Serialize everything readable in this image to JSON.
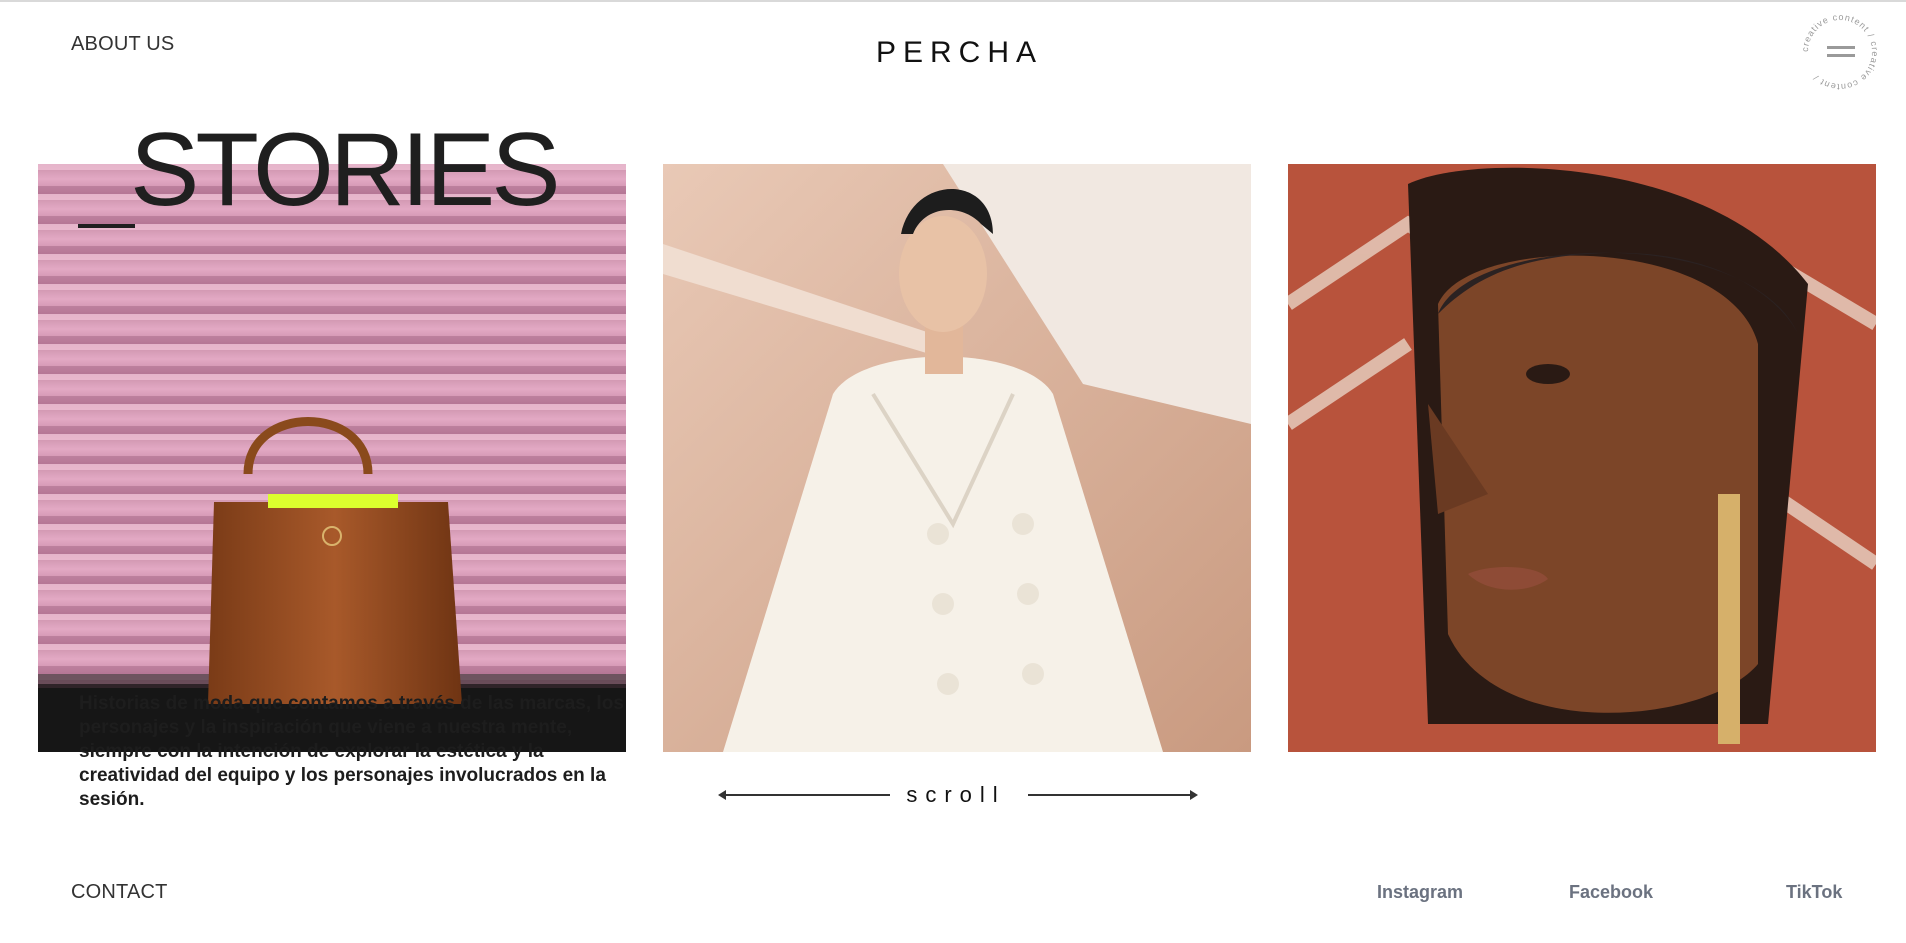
{
  "header": {
    "about_label": "ABOUT US",
    "logo_text": "PERCHA",
    "menu_badge_text": "creative content / creative content / ",
    "menu_icon": "hamburger-icon"
  },
  "hero": {
    "title": "STORIES",
    "description": "Historias de moda que contamos a través de las marcas, los personajes y la inspiración que viene a nuestra mente, siempre con la intención de explorar la estética y la creatividad del equipo y los personajes involucrados en la sesión."
  },
  "gallery": {
    "images": [
      {
        "subject": "handbag-photo"
      },
      {
        "subject": "white-coat-model-photo"
      },
      {
        "subject": "headscarf-portrait-photo"
      }
    ],
    "scroll_label": "scroll"
  },
  "footer": {
    "contact_label": "CONTACT",
    "socials": [
      "Instagram",
      "Facebook",
      "TikTok"
    ]
  },
  "colors": {
    "text": "#222222",
    "social": "#6b7280",
    "background": "#ffffff"
  }
}
